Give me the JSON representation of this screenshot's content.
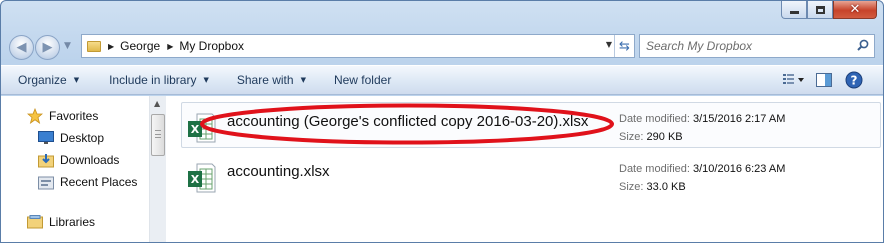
{
  "window": {
    "caption": {
      "minimize_icon": "minimize-icon",
      "maximize_icon": "maximize-icon",
      "close_icon": "close-icon"
    }
  },
  "nav": {
    "back_icon": "back-arrow-icon",
    "forward_icon": "forward-arrow-icon",
    "breadcrumbs": [
      "George",
      "My Dropbox"
    ],
    "search_placeholder": "Search My Dropbox"
  },
  "toolbar": {
    "organize": "Organize",
    "include_in_library": "Include in library",
    "share_with": "Share with",
    "new_folder": "New folder"
  },
  "sidebar": {
    "favorites": "Favorites",
    "items": [
      {
        "label": "Desktop",
        "icon": "desktop-icon"
      },
      {
        "label": "Downloads",
        "icon": "downloads-icon"
      },
      {
        "label": "Recent Places",
        "icon": "recent-places-icon"
      }
    ],
    "libraries": "Libraries"
  },
  "files": [
    {
      "name": "accounting (George's conflicted copy 2016-03-20).xlsx",
      "date_label": "Date modified:",
      "date": "3/15/2016 2:17 AM",
      "size_label": "Size:",
      "size": "290 KB",
      "icon": "excel-file-icon",
      "highlighted": true
    },
    {
      "name": "accounting.xlsx",
      "date_label": "Date modified:",
      "date": "3/10/2016 6:23 AM",
      "size_label": "Size:",
      "size": "33.0 KB",
      "icon": "excel-file-icon",
      "highlighted": false
    }
  ],
  "colors": {
    "highlight_ellipse": "#e0121b",
    "excel_green": "#1e7145",
    "chrome_blue": "#cfe0f2"
  }
}
